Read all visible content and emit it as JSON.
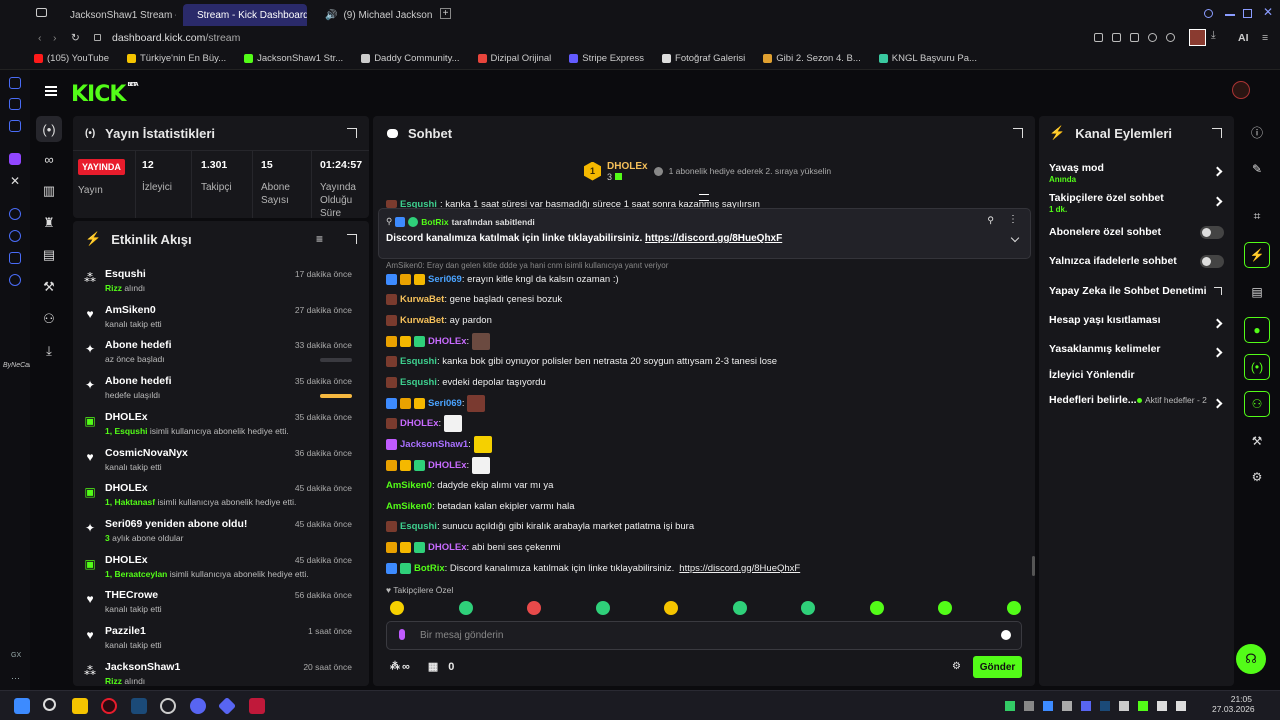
{
  "browser": {
    "tabs": [
      {
        "label": "JacksonShaw1 Stream - W"
      },
      {
        "label": "Stream - Kick Dashboard"
      },
      {
        "label": "(9) Michael Jackson - "
      }
    ],
    "url_host": "dashboard.kick.com",
    "url_path": "/stream",
    "ai_label": "AI",
    "bookmarks": [
      {
        "label": "(105) YouTube",
        "color": "#ff1a1a"
      },
      {
        "label": "Türkiye'nin En Büy...",
        "color": "#f5c400"
      },
      {
        "label": "JacksonShaw1 Str...",
        "color": "#53fc18"
      },
      {
        "label": "Daddy Community...",
        "color": "#cccccc"
      },
      {
        "label": "Dizipal Orijinal",
        "color": "#e8453c"
      },
      {
        "label": "Stripe Express",
        "color": "#635bff"
      },
      {
        "label": "Fotoğraf Galerisi",
        "color": "#dddddd"
      },
      {
        "label": "Gibi 2. Sezon 4. B...",
        "color": "#e0a030"
      },
      {
        "label": "KNGL Başvuru Pa...",
        "color": "#3ac9a0"
      }
    ]
  },
  "header": {
    "logo": "KICK",
    "logo_badge": "BETA"
  },
  "stats": {
    "title": "Yayın İstatistikleri",
    "live_badge": "YAYINDA",
    "live_label": "Yayın",
    "items": [
      {
        "value": "12",
        "label": "İzleyici"
      },
      {
        "value": "1.301",
        "label": "Takipçi"
      },
      {
        "value": "15",
        "label": "Abone Sayısı"
      },
      {
        "value": "01:24:57",
        "label": "Yayında Olduğu Süre"
      }
    ]
  },
  "activity": {
    "title": "Etkinlik Akışı",
    "events": [
      {
        "title": "Esqushi",
        "sub_hl": "Rizz",
        "sub": " alındı",
        "time": "17 dakika önce",
        "icon": "redeem-icon"
      },
      {
        "title": "AmSiken0",
        "sub_hl": "",
        "sub": "kanalı takip etti",
        "time": "27 dakika önce",
        "icon": "heart-icon"
      },
      {
        "title": "Abone hedefi",
        "sub_hl": "",
        "sub": "az önce başladı",
        "time": "33 dakika önce",
        "icon": "sparkle-icon",
        "progress": 0
      },
      {
        "title": "Abone hedefi",
        "sub_hl": "",
        "sub": "hedefe ulaşıldı",
        "time": "35 dakika önce",
        "icon": "sparkle-icon",
        "progress": 1
      },
      {
        "title": "DHOLEx",
        "sub_hl": "1, Esqushi",
        "sub": " isimli kullanıcıya abonelik hediye etti.",
        "time": "35 dakika önce",
        "icon": "gift-icon"
      },
      {
        "title": "CosmicNovaNyx",
        "sub_hl": "",
        "sub": "kanalı takip etti",
        "time": "36 dakika önce",
        "icon": "heart-icon"
      },
      {
        "title": "DHOLEx",
        "sub_hl": "1, Haktanasf",
        "sub": " isimli kullanıcıya abonelik hediye etti.",
        "time": "45 dakika önce",
        "icon": "gift-icon"
      },
      {
        "title": "Seri069 yeniden abone oldu!",
        "sub_hl": "3",
        "sub": " aylık abone oldular",
        "time": "45 dakika önce",
        "icon": "sparkle-icon"
      },
      {
        "title": "DHOLEx",
        "sub_hl": "1, Beraatceylan",
        "sub": " isimli kullanıcıya abonelik hediye etti.",
        "time": "45 dakika önce",
        "icon": "gift-icon"
      },
      {
        "title": "THECrowe",
        "sub_hl": "",
        "sub": "kanalı takip etti",
        "time": "56 dakika önce",
        "icon": "heart-icon"
      },
      {
        "title": "Pazzile1",
        "sub_hl": "",
        "sub": "kanalı takip etti",
        "time": "1 saat önce",
        "icon": "heart-icon"
      },
      {
        "title": "JacksonShaw1",
        "sub_hl": "Rizz",
        "sub": " alındı",
        "time": "20 saat önce",
        "icon": "redeem-icon"
      }
    ]
  },
  "chat": {
    "title": "Sohbet",
    "top_gifter": {
      "rank": "1",
      "name": "DHOLEx",
      "count": "3",
      "note": "1 abonelik hediye ederek 2. sıraya yükselin"
    },
    "pinned": {
      "author": "BotRix",
      "label": "tarafından sabitlendi",
      "text": "Discord kanalımıza katılmak için linke tıklayabilirsiniz.",
      "link": "https://discord.gg/8HueQhxF"
    },
    "partial_line": {
      "user": "Esqushi",
      "text": ": kanka 1 saat süresi var basmadığı sürece 1 saat sonra kazanmış sayılırsın"
    },
    "reply_context": "AmSiken0: Eray dan gelen kitle ddde ya hani cnm isimli kullanıcıya yanıt veriyor",
    "messages": [
      {
        "user": "Seri069",
        "color": "#4aa3ff",
        "text": ": erayın kitle kngl da kalsın ozaman :)",
        "badges": [
          "#3d8bff",
          "#e9a100",
          "#f5b800"
        ]
      },
      {
        "user": "KurwaBet",
        "color": "#f5c05a",
        "text": ": gene başladı çenesi bozuk",
        "badges": [
          "#7a3b2e"
        ]
      },
      {
        "user": "KurwaBet",
        "color": "#f5c05a",
        "text": ": ay pardon",
        "badges": [
          "#7a3b2e"
        ]
      },
      {
        "user": "DHOLEx",
        "color": "#c86bff",
        "text": ":",
        "badges": [
          "#e9a100",
          "#f5b800",
          "#2fd07a"
        ],
        "emote": "#6b4a40"
      },
      {
        "user": "Esqushi",
        "color": "#3ecf8e",
        "text": ": kanka bok gibi oynuyor polisler ben netrasta 20 soygun attıysam 2-3 tanesi lose",
        "badges": [
          "#7a3b2e"
        ]
      },
      {
        "user": "Esqushi",
        "color": "#3ecf8e",
        "text": ": evdeki depolar taşıyordu",
        "badges": [
          "#7a3b2e"
        ]
      },
      {
        "user": "Seri069",
        "color": "#4aa3ff",
        "text": ":",
        "badges": [
          "#3d8bff",
          "#e9a100",
          "#f5b800"
        ],
        "emote": "#7a3a30"
      },
      {
        "user": "DHOLEx",
        "color": "#c86bff",
        "text": ":",
        "badges": [
          "#7a3b2e"
        ],
        "emote": "#f2f2f2"
      },
      {
        "user": "JacksonShaw1",
        "color": "#a970ff",
        "text": ":",
        "badges": [
          "#c05bff"
        ],
        "emote": "#f5d000"
      },
      {
        "user": "DHOLEx",
        "color": "#c86bff",
        "text": ":",
        "badges": [
          "#e9a100",
          "#f5b800",
          "#2fd07a"
        ],
        "emote": "#f2f2f2"
      },
      {
        "user": "AmSiken0",
        "color": "#53fc18",
        "text": ": dadyde ekip alımı var mı ya",
        "badges": []
      },
      {
        "user": "AmSiken0",
        "color": "#53fc18",
        "text": ": betadan kalan ekipler varmı hala",
        "badges": []
      },
      {
        "user": "Esqushi",
        "color": "#3ecf8e",
        "text": ": sunucu açıldığı gibi kiralık arabayla market patlatma işi bura",
        "badges": [
          "#7a3b2e"
        ]
      },
      {
        "user": "DHOLEx",
        "color": "#c86bff",
        "text": ": abi beni ses çekenmi",
        "badges": [
          "#e9a100",
          "#f5b800",
          "#2fd07a"
        ]
      },
      {
        "user": "BotRix",
        "color": "#53fc18",
        "text": ": Discord kanalımıza katılmak için linke tıklayabilirsiniz.",
        "link": "https://discord.gg/8HueQhxF",
        "badges": [
          "#3d8bff",
          "#2fd07a"
        ]
      }
    ],
    "emote_section": "Takipçilere Özel",
    "input_placeholder": "Bir mesaj gönderin",
    "points": "∞",
    "store_count": "0",
    "send_label": "Gönder"
  },
  "actions": {
    "title": "Kanal Eylemleri",
    "items": [
      {
        "label": "Yavaş mod",
        "sub": "Anında",
        "control": "chevron"
      },
      {
        "label": "Takipçilere özel sohbet",
        "sub": "1 dk.",
        "control": "chevron"
      },
      {
        "label": "Abonelere özel sohbet",
        "sub": "",
        "control": "toggle",
        "value": false
      },
      {
        "label": "Yalnızca ifadelerle sohbet",
        "sub": "",
        "control": "toggle",
        "value": false
      },
      {
        "label": "Yapay Zeka ile Sohbet Denetimi",
        "sub": "",
        "control": "external"
      },
      {
        "label": "Hesap yaşı kısıtlaması",
        "sub": "",
        "control": "chevron"
      },
      {
        "label": "Yasaklanmış kelimeler",
        "sub": "",
        "control": "chevron"
      },
      {
        "label": "İzleyici Yönlendir",
        "sub": "",
        "control": "none"
      },
      {
        "label": "Hedefleri belirle...",
        "sub": "",
        "control": "chevron",
        "badge": "Aktif hedefler - 2"
      }
    ]
  },
  "sidebar_left_text": "ByNeCarie",
  "taskbar": {
    "time": "21:05",
    "date": "27.03.2026"
  },
  "colors": {
    "accent": "#53fc18",
    "panel": "#17171b",
    "bg": "#0b0b0e",
    "live": "#e81c2c"
  }
}
